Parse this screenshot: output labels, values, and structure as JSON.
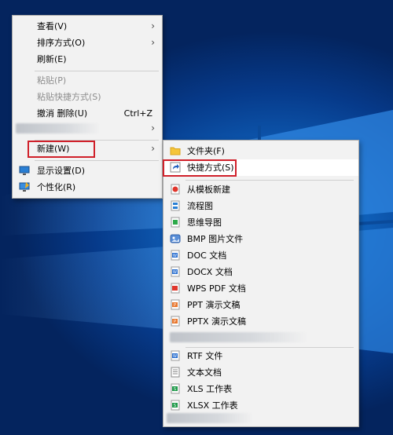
{
  "context_menu": {
    "items": [
      {
        "label": "查看(V)"
      },
      {
        "label": "排序方式(O)"
      },
      {
        "label": "刷新(E)"
      },
      {
        "label": "粘贴(P)"
      },
      {
        "label": "粘贴快捷方式(S)"
      },
      {
        "label": "撤消 删除(U)",
        "shortcut": "Ctrl+Z"
      },
      {
        "label": "新建(W)"
      },
      {
        "label": "显示设置(D)"
      },
      {
        "label": "个性化(R)"
      }
    ]
  },
  "new_submenu": {
    "items": [
      {
        "label": "文件夹(F)",
        "icon": "folder-icon"
      },
      {
        "label": "快捷方式(S)",
        "icon": "shortcut-icon"
      },
      {
        "label": "从模板新建",
        "icon": "template-icon"
      },
      {
        "label": "流程图",
        "icon": "flowchart-icon"
      },
      {
        "label": "思维导图",
        "icon": "mindmap-icon"
      },
      {
        "label": "BMP 图片文件",
        "icon": "bmp-image-icon"
      },
      {
        "label": "DOC 文档",
        "icon": "doc-document-icon"
      },
      {
        "label": "DOCX 文档",
        "icon": "docx-document-icon"
      },
      {
        "label": "WPS PDF 文档",
        "icon": "wps-pdf-icon"
      },
      {
        "label": "PPT 演示文稿",
        "icon": "ppt-icon"
      },
      {
        "label": "PPTX 演示文稿",
        "icon": "pptx-icon"
      },
      {
        "label": "RTF 文件",
        "icon": "rtf-file-icon"
      },
      {
        "label": "文本文档",
        "icon": "text-document-icon"
      },
      {
        "label": "XLS 工作表",
        "icon": "xls-icon"
      },
      {
        "label": "XLSX 工作表",
        "icon": "xlsx-icon"
      }
    ]
  },
  "colors": {
    "highlight_box": "#d0202a",
    "menu_bg": "#f2f2f2",
    "desktop_blue": "#0f5fb8"
  }
}
